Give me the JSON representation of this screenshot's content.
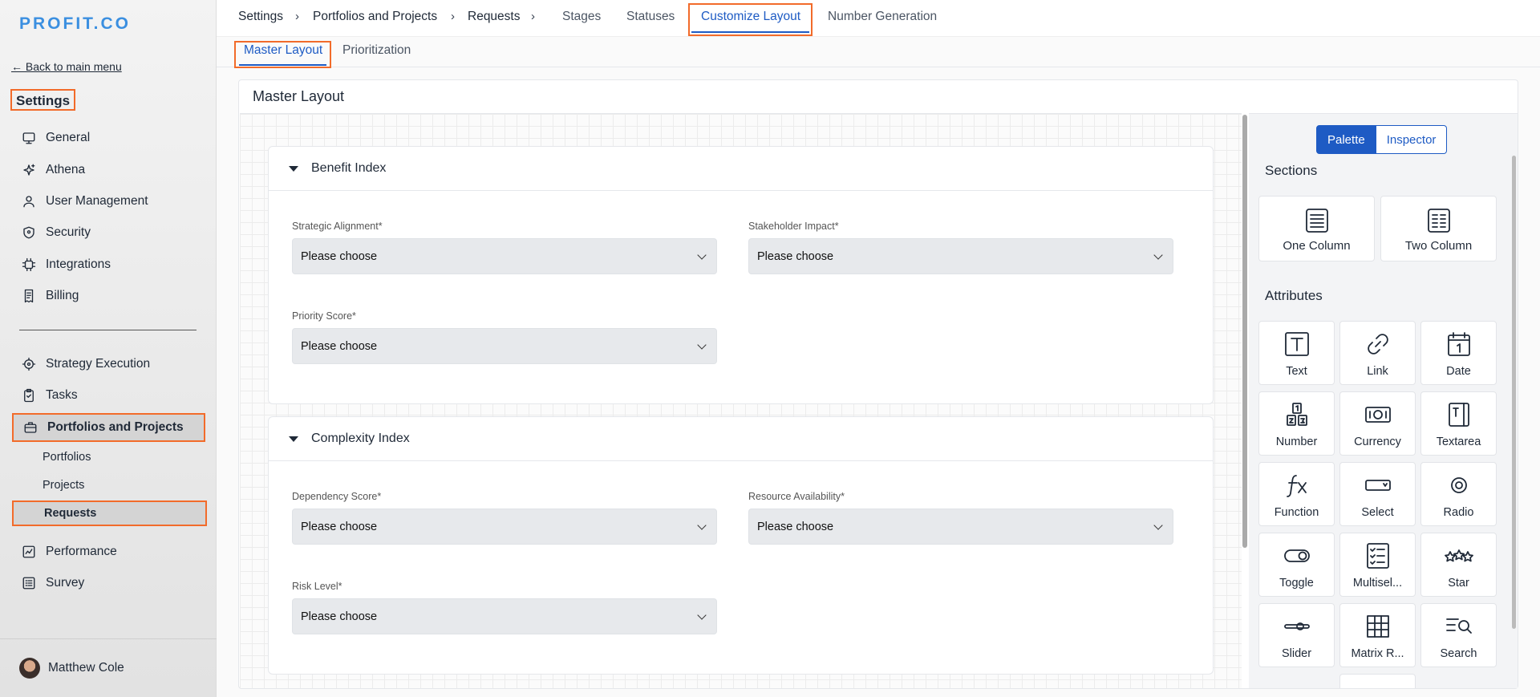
{
  "sidebar": {
    "logo": "PROFIT.CO",
    "back_link": "← Back to main menu",
    "title": "Settings",
    "items_top": [
      {
        "label": "General",
        "icon": "monitor-icon"
      },
      {
        "label": "Athena",
        "icon": "sparkle-icon"
      },
      {
        "label": "User Management",
        "icon": "user-icon"
      },
      {
        "label": "Security",
        "icon": "shield-icon"
      },
      {
        "label": "Integrations",
        "icon": "chip-icon"
      },
      {
        "label": "Billing",
        "icon": "receipt-icon"
      }
    ],
    "items_bottom": [
      {
        "label": "Strategy Execution",
        "icon": "target-icon"
      },
      {
        "label": "Tasks",
        "icon": "clipboard-check-icon"
      },
      {
        "label": "Portfolios and Projects",
        "icon": "briefcase-icon"
      },
      {
        "label": "Performance",
        "icon": "chart-icon"
      },
      {
        "label": "Survey",
        "icon": "list-icon"
      }
    ],
    "sub_items": [
      "Portfolios",
      "Projects",
      "Requests"
    ],
    "user_name": "Matthew Cole"
  },
  "topnav": {
    "breadcrumbs": [
      "Settings",
      "Portfolios and Projects",
      "Requests"
    ],
    "separator": "›",
    "tabs": [
      "Stages",
      "Statuses",
      "Customize Layout",
      "Number Generation"
    ]
  },
  "subtabs": [
    "Master Layout",
    "Prioritization"
  ],
  "panel": {
    "title": "Master Layout",
    "sections": [
      {
        "title": "Benefit Index",
        "fields": [
          {
            "label": "Strategic Alignment*",
            "value": "Please choose"
          },
          {
            "label": "Stakeholder Impact*",
            "value": "Please choose"
          },
          {
            "label": "Priority Score*",
            "value": "Please choose"
          }
        ]
      },
      {
        "title": "Complexity Index",
        "fields": [
          {
            "label": "Dependency Score*",
            "value": "Please choose"
          },
          {
            "label": "Resource Availability*",
            "value": "Please choose"
          },
          {
            "label": "Risk Level*",
            "value": "Please choose"
          }
        ]
      }
    ]
  },
  "palette": {
    "toggle": [
      "Palette",
      "Inspector"
    ],
    "sections_heading": "Sections",
    "sections": [
      "One Column",
      "Two Column"
    ],
    "attributes_heading": "Attributes",
    "attributes": [
      "Text",
      "Link",
      "Date",
      "Number",
      "Currency",
      "Textarea",
      "Function",
      "Select",
      "Radio",
      "Toggle",
      "Multisel...",
      "Star",
      "Slider",
      "Matrix R...",
      "Search"
    ]
  },
  "colors": {
    "accent": "#1e5bc4",
    "highlight": "#f26b2a",
    "logo": "#3b8fe0"
  }
}
